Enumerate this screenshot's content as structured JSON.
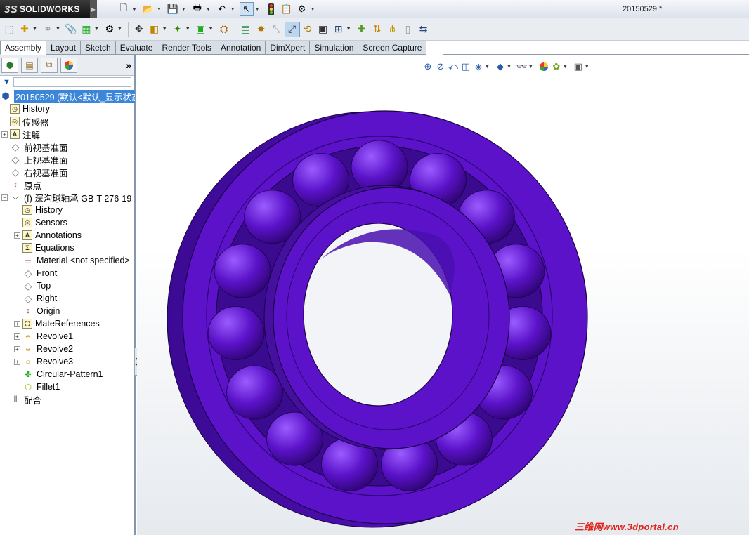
{
  "app": {
    "logo_text": "SOLIDWORKS",
    "logo_mark": "3S",
    "document_title": "20150529 *"
  },
  "tabs": [
    {
      "label": "Assembly",
      "active": true
    },
    {
      "label": "Layout",
      "active": false
    },
    {
      "label": "Sketch",
      "active": false
    },
    {
      "label": "Evaluate",
      "active": false
    },
    {
      "label": "Render Tools",
      "active": false
    },
    {
      "label": "Annotation",
      "active": false
    },
    {
      "label": "DimXpert",
      "active": false
    },
    {
      "label": "Simulation",
      "active": false
    },
    {
      "label": "Screen Capture",
      "active": false
    }
  ],
  "panel": {
    "expand_glyph": "»"
  },
  "tree": {
    "root": {
      "label": "20150529  (默认<默认_显示状态"
    },
    "items": [
      {
        "label": "History",
        "icon": "history-icon",
        "level": 1,
        "expand": false
      },
      {
        "label": "传感器",
        "icon": "sensor-icon",
        "level": 1,
        "expand": false
      },
      {
        "label": "注解",
        "icon": "annotation-icon",
        "level": 1,
        "expand": true
      },
      {
        "label": "前视基准面",
        "icon": "plane-icon",
        "level": 1,
        "expand": false
      },
      {
        "label": "上视基准面",
        "icon": "plane-icon",
        "level": 1,
        "expand": false
      },
      {
        "label": "右视基准面",
        "icon": "plane-icon",
        "level": 1,
        "expand": false
      },
      {
        "label": "原点",
        "icon": "origin-icon",
        "level": 1,
        "expand": false
      },
      {
        "label": "(f) 深沟球轴承 GB-T 276-19",
        "icon": "part-icon",
        "level": 1,
        "expand": true,
        "expanded": true
      },
      {
        "label": "History",
        "icon": "history-icon",
        "level": 2,
        "expand": false
      },
      {
        "label": "Sensors",
        "icon": "sensor-icon",
        "level": 2,
        "expand": false
      },
      {
        "label": "Annotations",
        "icon": "annotation-icon",
        "level": 2,
        "expand": true
      },
      {
        "label": "Equations",
        "icon": "equation-icon",
        "level": 2,
        "expand": false
      },
      {
        "label": "Material <not specified>",
        "icon": "material-icon",
        "level": 2,
        "expand": false
      },
      {
        "label": "Front",
        "icon": "plane-icon",
        "level": 2,
        "expand": false
      },
      {
        "label": "Top",
        "icon": "plane-icon",
        "level": 2,
        "expand": false
      },
      {
        "label": "Right",
        "icon": "plane-icon",
        "level": 2,
        "expand": false
      },
      {
        "label": "Origin",
        "icon": "origin-icon",
        "level": 2,
        "expand": false
      },
      {
        "label": "MateReferences",
        "icon": "mate-reference-icon",
        "level": 2,
        "expand": true
      },
      {
        "label": "Revolve1",
        "icon": "revolve-icon",
        "level": 2,
        "expand": true
      },
      {
        "label": "Revolve2",
        "icon": "revolve-icon",
        "level": 2,
        "expand": true
      },
      {
        "label": "Revolve3",
        "icon": "revolve-icon",
        "level": 2,
        "expand": true
      },
      {
        "label": "Circular-Pattern1",
        "icon": "circular-pattern-icon",
        "level": 2,
        "expand": false
      },
      {
        "label": "Fillet1",
        "icon": "fillet-icon",
        "level": 2,
        "expand": false
      },
      {
        "label": "配合",
        "icon": "mates-icon",
        "level": 0,
        "expand": false
      }
    ]
  },
  "viewport": {
    "model_color": "#5b12c9",
    "watermark": "三维网www.3dportal.cn"
  },
  "colors": {
    "selection_blue": "#3c86d9",
    "model_purple": "#5b12c9",
    "model_dark": "#2e0573",
    "watermark_red": "#e0241b"
  }
}
